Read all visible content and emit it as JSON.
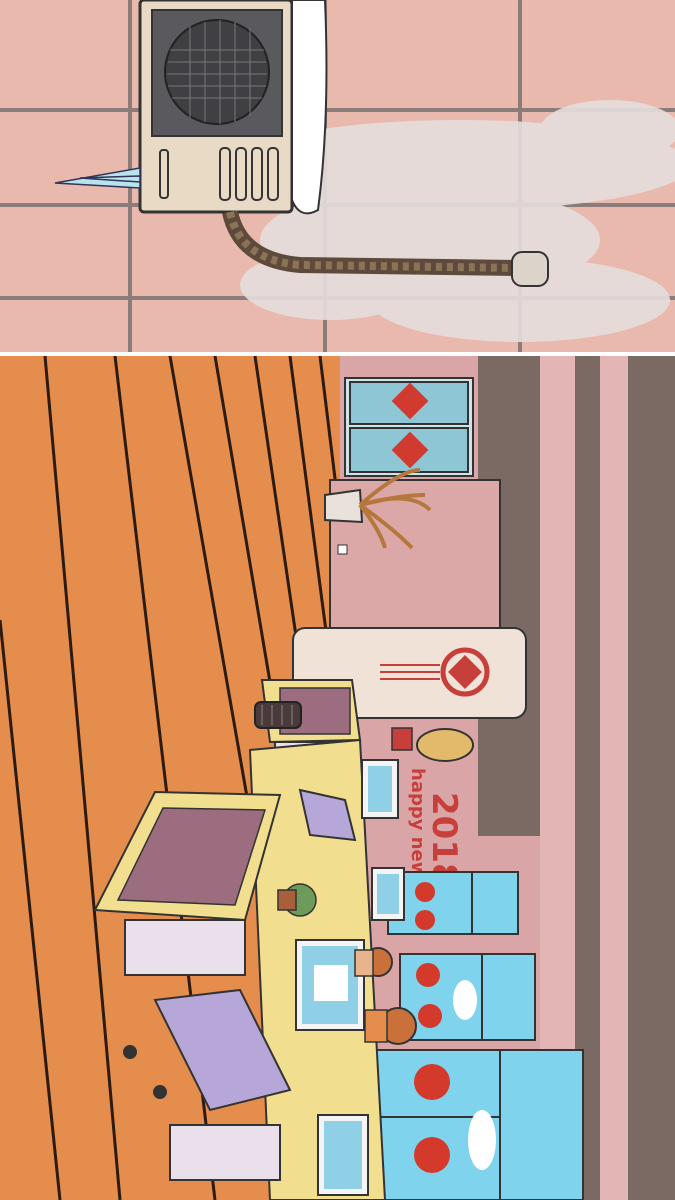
{
  "scene": {
    "title": "",
    "colors": {
      "tile_top": "#e9b9ae",
      "grout": "#8b7c79",
      "floor": "#e48d4d",
      "wall": "#d9a5a7",
      "red": "#c73f3a",
      "desk": "#f1df8f",
      "chair": "#b6a7d8",
      "window": "#7fd3ec"
    },
    "banner": {
      "year": "2018",
      "greeting": "happy new year"
    },
    "window_char": "福",
    "air_conditioner": {
      "label": "air conditioner (frozen, leaking frost)"
    }
  }
}
